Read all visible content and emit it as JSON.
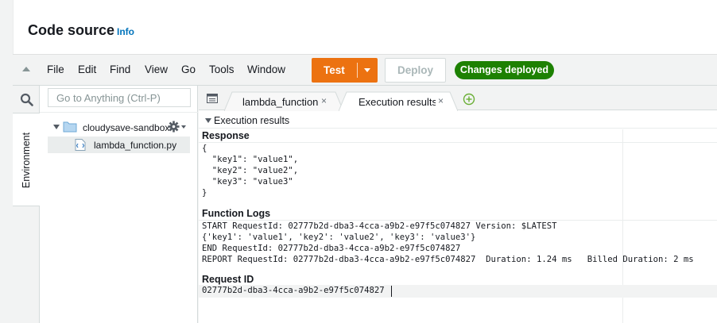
{
  "header": {
    "title": "Code source",
    "info": "Info"
  },
  "menu": [
    "File",
    "Edit",
    "Find",
    "View",
    "Go",
    "Tools",
    "Window"
  ],
  "toolbar": {
    "test_label": "Test",
    "deploy_label": "Deploy",
    "status_badge": "Changes deployed"
  },
  "sidebar": {
    "goto_placeholder": "Go to Anything (Ctrl-P)",
    "environment_tab": "Environment",
    "folder": "cloudysave-sandbox-",
    "file": "lambda_function.py"
  },
  "tabs": [
    {
      "label": "lambda_function",
      "close": "×"
    },
    {
      "label": "Execution results",
      "close": "×"
    }
  ],
  "results": {
    "header": "Execution results",
    "response_title": "Response",
    "response_lines": [
      "{",
      "  \"key1\": \"value1\",",
      "  \"key2\": \"value2\",",
      "  \"key3\": \"value3\"",
      "}"
    ],
    "logs_title": "Function Logs",
    "log_lines": [
      "START RequestId: 02777b2d-dba3-4cca-a9b2-e97f5c074827 Version: $LATEST",
      "{'key1': 'value1', 'key2': 'value2', 'key3': 'value3'}",
      "END RequestId: 02777b2d-dba3-4cca-a9b2-e97f5c074827",
      "REPORT RequestId: 02777b2d-dba3-4cca-a9b2-e97f5c074827  Duration: 1.24 ms   Billed Duration: 2 ms"
    ],
    "request_id_title": "Request ID",
    "request_id": "02777b2d-dba3-4cca-a9b2-e97f5c074827"
  },
  "colors": {
    "accent": "#ec7211",
    "success": "#1d8102",
    "link": "#0073bb"
  }
}
